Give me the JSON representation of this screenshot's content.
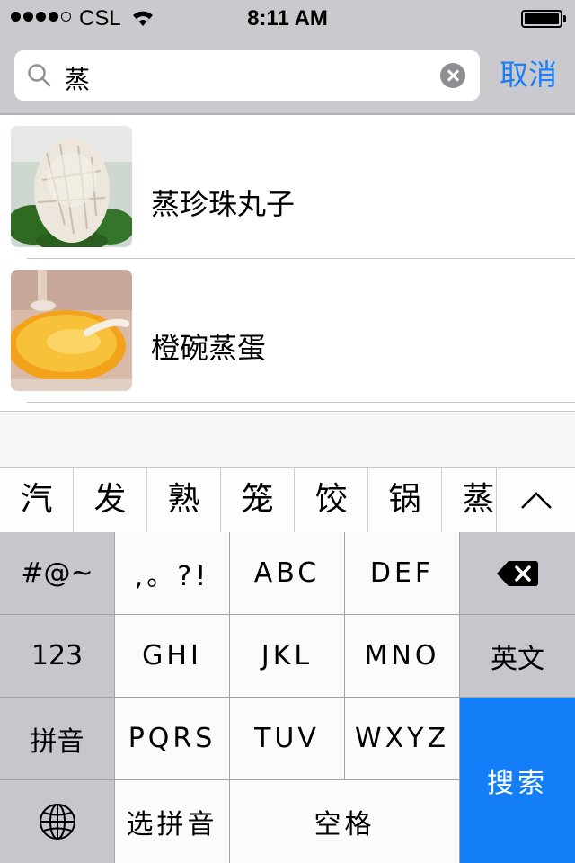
{
  "status_bar": {
    "carrier": "CSL",
    "time": "8:11 AM",
    "signal_bars": 4
  },
  "search": {
    "query": "蒸",
    "cancel_label": "取消"
  },
  "results": [
    {
      "title": "蒸珍珠丸子",
      "thumbnail": "pearl-meatballs-photo"
    },
    {
      "title": "橙碗蒸蛋",
      "thumbnail": "orange-bowl-steamed-egg-photo"
    }
  ],
  "candidates": [
    "汽",
    "发",
    "熟",
    "笼",
    "饺",
    "锅",
    "蒸"
  ],
  "keyboard": {
    "row1": [
      "#@~",
      ",。?!",
      "ABC",
      "DEF"
    ],
    "row2": [
      "123",
      "GHI",
      "JKL",
      "MNO",
      "英文"
    ],
    "row3": [
      "拼音",
      "PQRS",
      "TUV",
      "WXYZ"
    ],
    "row4": [
      "选拼音",
      "空格"
    ],
    "search_label": "搜索"
  },
  "colors": {
    "accent": "#1a7ef7",
    "search_key": "#137ef7",
    "bar_background": "#c9c9ce"
  }
}
